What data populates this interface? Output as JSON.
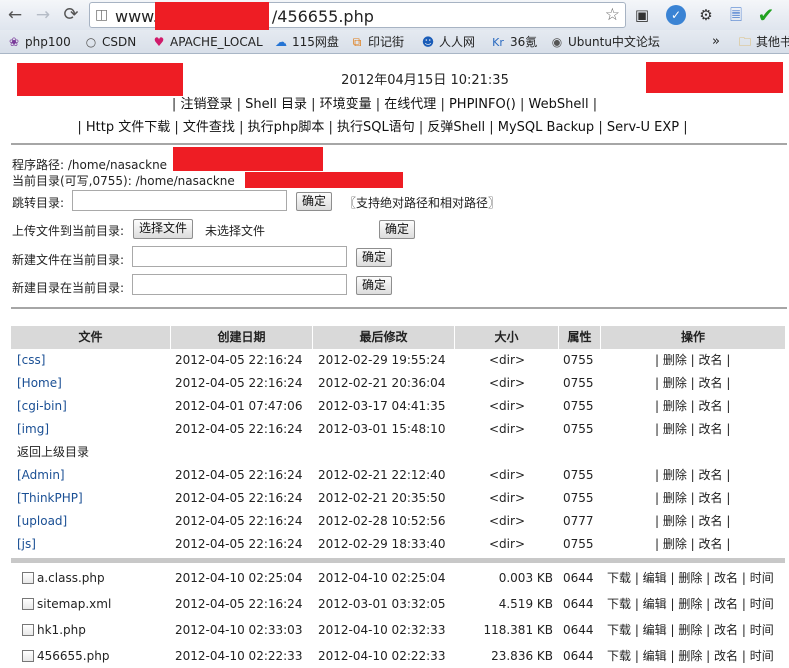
{
  "browser": {
    "url_visible_start": "www.",
    "url_visible_end": "/456655.php",
    "bookmarks": [
      "php100",
      "CSDN",
      "APACHE_LOCAL",
      "115网盘",
      "印记街",
      "人人网",
      "36氪",
      "Ubuntu中文论坛",
      "其他书"
    ],
    "bookmark_icons": [
      "paw",
      "c-circle",
      "heart",
      "115",
      "cart",
      "person",
      "kr",
      "globe",
      "folder"
    ],
    "overflow_chevron": "»",
    "kr_prefix": "Kr"
  },
  "header": {
    "datetime": "2012年04月15日 10:21:35",
    "nav_row1": [
      "注销登录",
      "Shell 目录",
      "环境变量",
      "在线代理",
      "PHPINFO()",
      "WebShell"
    ],
    "nav_row2": [
      "Http 文件下载",
      "文件查找",
      "执行php脚本",
      "执行SQL语句",
      "反弹Shell",
      "MySQL Backup",
      "Serv-U EXP"
    ]
  },
  "paths": {
    "program_label": "程序路径: /home/nasackne",
    "current_label": "当前目录(可写,0755): /home/nasackne"
  },
  "forms": {
    "jump_label": "跳转目录:",
    "jump_button": "确定",
    "jump_note": "〖支持绝对路径和相对路径〗",
    "upload_label": "上传文件到当前目录:",
    "choose_file": "选择文件",
    "no_file": "未选择文件",
    "upload_button": "确定",
    "newfile_label": "新建文件在当前目录:",
    "newfile_button": "确定",
    "newdir_label": "新建目录在当前目录:",
    "newdir_button": "确定"
  },
  "table": {
    "headers": [
      "文件",
      "创建日期",
      "最后修改",
      "大小",
      "属性",
      "操作"
    ],
    "dirs_top": [
      {
        "name": "[css]",
        "created": "2012-04-05 22:16:24",
        "modified": "2012-02-29 19:55:24",
        "size": "<dir>",
        "perm": "0755",
        "ops": "| 删除 | 改名 |"
      },
      {
        "name": "[Home]",
        "created": "2012-04-05 22:16:24",
        "modified": "2012-02-21 20:36:04",
        "size": "<dir>",
        "perm": "0755",
        "ops": "| 删除 | 改名 |"
      },
      {
        "name": "[cgi-bin]",
        "created": "2012-04-01 07:47:06",
        "modified": "2012-03-17 04:41:35",
        "size": "<dir>",
        "perm": "0755",
        "ops": "| 删除 | 改名 |"
      },
      {
        "name": "[img]",
        "created": "2012-04-05 22:16:24",
        "modified": "2012-03-01 15:48:10",
        "size": "<dir>",
        "perm": "0755",
        "ops": "| 删除 | 改名 |"
      }
    ],
    "parent_label": "返回上级目录",
    "dirs_bottom": [
      {
        "name": "[Admin]",
        "created": "2012-04-05 22:16:24",
        "modified": "2012-02-21 22:12:40",
        "size": "<dir>",
        "perm": "0755",
        "ops": "| 删除 | 改名 |"
      },
      {
        "name": "[ThinkPHP]",
        "created": "2012-04-05 22:16:24",
        "modified": "2012-02-21 20:35:50",
        "size": "<dir>",
        "perm": "0755",
        "ops": "| 删除 | 改名 |"
      },
      {
        "name": "[upload]",
        "created": "2012-04-05 22:16:24",
        "modified": "2012-02-28 10:52:56",
        "size": "<dir>",
        "perm": "0777",
        "ops": "| 删除 | 改名 |"
      },
      {
        "name": "[js]",
        "created": "2012-04-05 22:16:24",
        "modified": "2012-02-29 18:33:40",
        "size": "<dir>",
        "perm": "0755",
        "ops": "| 删除 | 改名 |"
      }
    ],
    "files": [
      {
        "name": "a.class.php",
        "created": "2012-04-10 02:25:04",
        "modified": "2012-04-10 02:25:04",
        "size": "0.003 KB",
        "perm": "0644",
        "ops": "下载 | 编辑 | 删除 | 改名 | 时间"
      },
      {
        "name": "sitemap.xml",
        "created": "2012-04-05 22:16:24",
        "modified": "2012-03-01 03:32:05",
        "size": "4.519 KB",
        "perm": "0644",
        "ops": "下载 | 编辑 | 删除 | 改名 | 时间"
      },
      {
        "name": "hk1.php",
        "created": "2012-04-10 02:33:03",
        "modified": "2012-04-10 02:32:33",
        "size": "118.381 KB",
        "perm": "0644",
        "ops": "下载 | 编辑 | 删除 | 改名 | 时间"
      },
      {
        "name": "456655.php",
        "created": "2012-04-10 02:22:33",
        "modified": "2012-04-10 02:22:33",
        "size": "23.836 KB",
        "perm": "0644",
        "ops": "下载 | 编辑 | 删除 | 改名 | 时间"
      }
    ]
  },
  "colors": {
    "redaction": "#ee1d24",
    "link": "#1a4f94",
    "header_bg": "#d9d9d9"
  }
}
